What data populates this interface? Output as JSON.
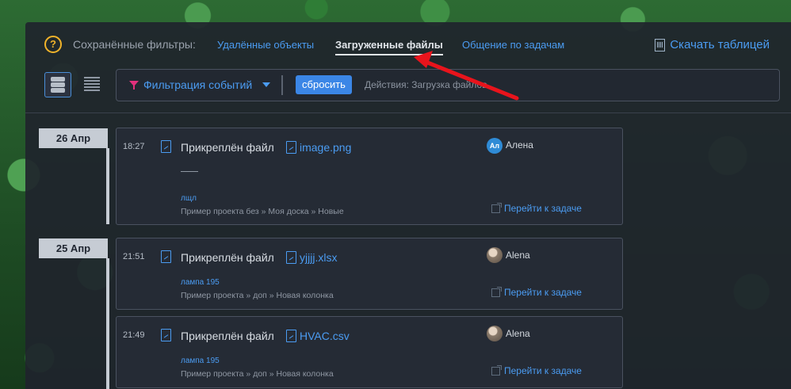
{
  "header": {
    "help_glyph": "?",
    "saved_filters_label": "Сохранённые фильтры:",
    "tabs": [
      {
        "label": "Удалённые объекты",
        "active": false
      },
      {
        "label": "Загруженные файлы",
        "active": true
      },
      {
        "label": "Общение по задачам",
        "active": false
      }
    ],
    "download_label": "Скачать таблицей"
  },
  "filter_bar": {
    "filter_label": "Фильтрация событий",
    "reset_label": "сбросить",
    "actions_text": "Действия: Загрузка файлов"
  },
  "groups": [
    {
      "date": "26 Апр",
      "events": [
        {
          "time": "18:27",
          "title": "Прикреплён файл",
          "file": "image.png",
          "user": "Алена",
          "avatar": "initials",
          "avatar_text": "Ал",
          "comment": "——",
          "task": "лщл",
          "path": "Пример проекта без » Моя доска » Новые",
          "goto_label": "Перейти к задаче"
        }
      ]
    },
    {
      "date": "25 Апр",
      "events": [
        {
          "time": "21:51",
          "title": "Прикреплён файл",
          "file": "yjjjj.xlsx",
          "user": "Alena",
          "avatar": "photo",
          "task": "лампа 195",
          "path": "Пример проекта » доп » Новая колонка",
          "goto_label": "Перейти к задаче"
        },
        {
          "time": "21:49",
          "title": "Прикреплён файл",
          "file": "HVAC.csv",
          "user": "Alena",
          "avatar": "photo",
          "task": "лампа 195",
          "path": "Пример проекта » доп » Новая колонка",
          "goto_label": "Перейти к задаче"
        }
      ]
    }
  ],
  "colors": {
    "accent": "#4b9cf2",
    "help": "#f0b32a",
    "funnel": "#e2307c",
    "annotation_arrow": "#e8141c"
  }
}
